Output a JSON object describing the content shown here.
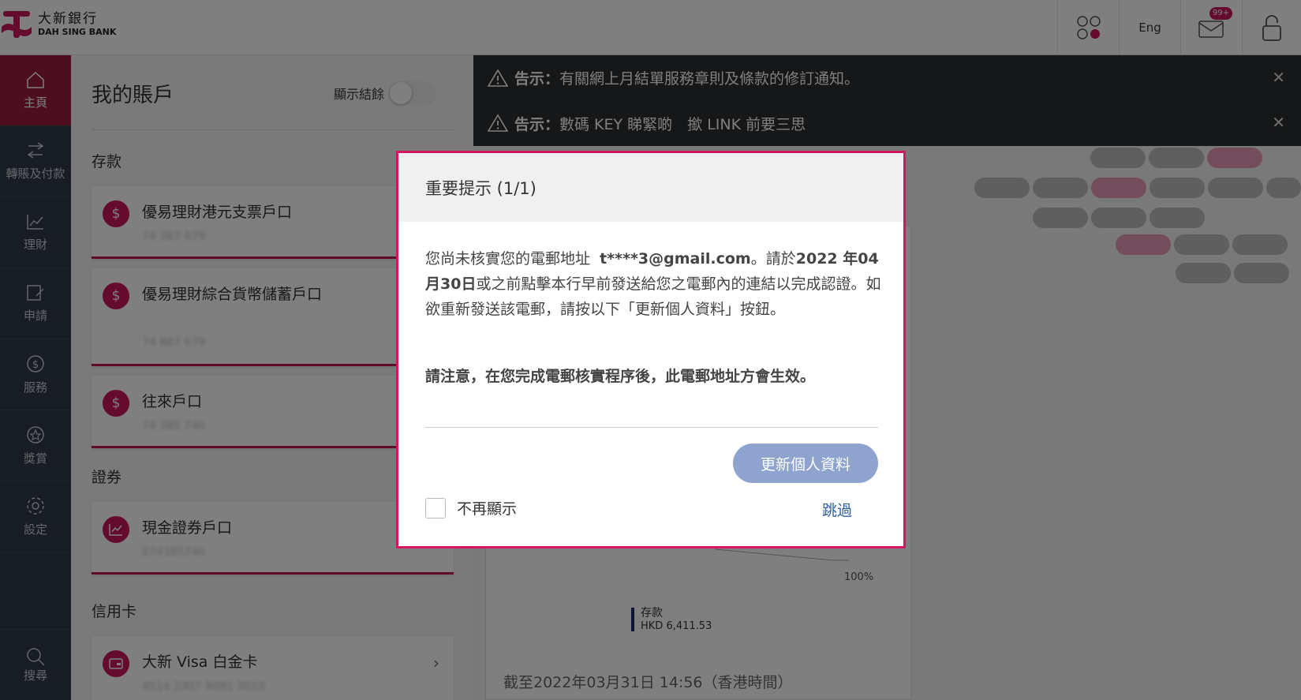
{
  "header": {
    "logo_cn": "大新銀行",
    "logo_en": "DAH SING BANK",
    "lang": "Eng",
    "mail_badge": "99+"
  },
  "sidebar": {
    "items": [
      {
        "label": "主頁",
        "icon": "home-icon"
      },
      {
        "label": "轉賬及付款",
        "icon": "transfer-icon"
      },
      {
        "label": "理財",
        "icon": "chart-icon"
      },
      {
        "label": "申請",
        "icon": "apply-icon"
      },
      {
        "label": "服務",
        "icon": "service-icon"
      },
      {
        "label": "獎賞",
        "icon": "reward-icon"
      },
      {
        "label": "設定",
        "icon": "gear-icon"
      }
    ],
    "search": "搜尋"
  },
  "accounts": {
    "title": "我的賬戶",
    "toggle_label": "顯示結餘",
    "deposits_label": "存款",
    "deposits": [
      {
        "name": "優易理財港元支票戶口",
        "number": "74 387 679"
      },
      {
        "name": "優易理財綜合貨幣儲蓄戶口",
        "number": "74 887 679"
      },
      {
        "name": "往來戶口",
        "number": "74 385 740"
      }
    ],
    "securities_label": "證券",
    "securities": [
      {
        "name": "現金證券戶口",
        "number": "874385740"
      }
    ],
    "credit_label": "信用卡",
    "credit": [
      {
        "name": "大新 Visa 白金卡",
        "number": "4514 2307 8091 3010"
      }
    ]
  },
  "notices": [
    {
      "prefix": "告示：",
      "text": "有關網上月結單服務章則及條款的修訂通知。"
    },
    {
      "prefix": "告示：",
      "text": "數碼 KEY 睇緊啲　撳 LINK 前要三思"
    }
  ],
  "summary": {
    "legend_name": "存款",
    "legend_value": "HKD 6,411.53",
    "percent": "100%",
    "as_of": "截至2022年03月31日 14:56（香港時間）"
  },
  "modal": {
    "title": "重要提示 (1/1)",
    "body_1": "您尚未核實您的電郵地址",
    "email": "t****3@gmail.com",
    "body_2": "。請於",
    "date": "2022 年04月30日",
    "body_3": "或之前點擊本行早前發送給您之電郵內的連結以完成認證。如欲重新發送該電郵，請按以下「更新個人資料」按鈕。",
    "note": "請注意，在您完成電郵核實程序後，此電郵地址方會生效。",
    "update_button": "更新個人資料",
    "dont_show": "不再顯示",
    "skip": "跳過"
  },
  "colors": {
    "brand": "#c8175d",
    "sidebar_bg": "#2f3a46",
    "button": "#8ea3ce",
    "link": "#2e5f9e"
  }
}
